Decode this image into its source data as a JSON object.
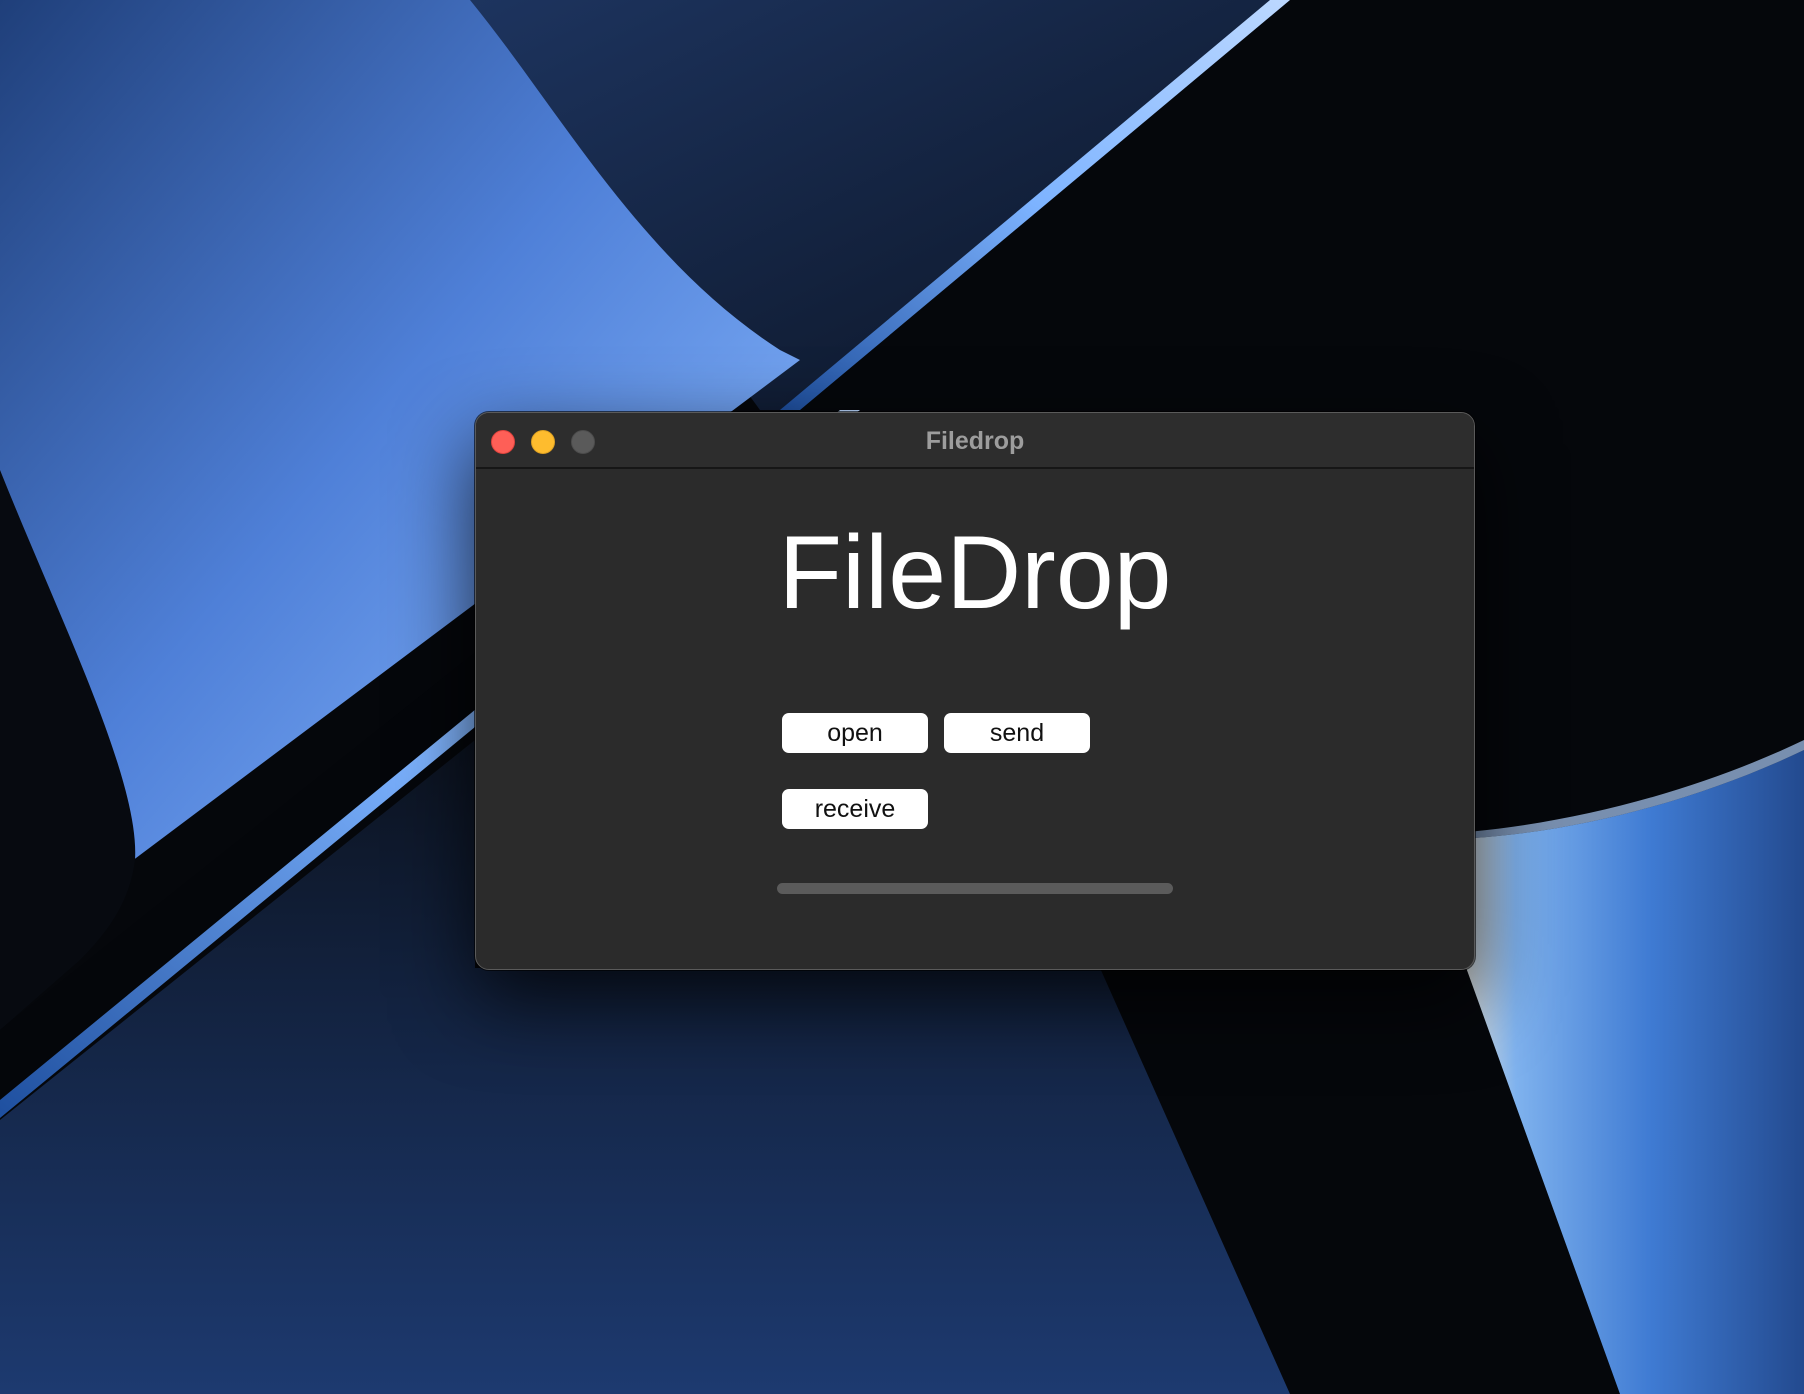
{
  "window": {
    "title": "Filedrop",
    "traffic_lights": {
      "close_color": "#fe5f57",
      "minimize_color": "#febc2e",
      "zoom_color": "#5a5a5a"
    }
  },
  "app": {
    "heading": "FileDrop",
    "buttons": {
      "open_label": "open",
      "send_label": "send",
      "receive_label": "receive"
    },
    "progress": {
      "value": 0
    }
  },
  "colors": {
    "window_background": "#2b2b2b",
    "button_background": "#ffffff",
    "progress_track": "#5b5b5b",
    "wallpaper_accent": "#6fa3f0"
  }
}
